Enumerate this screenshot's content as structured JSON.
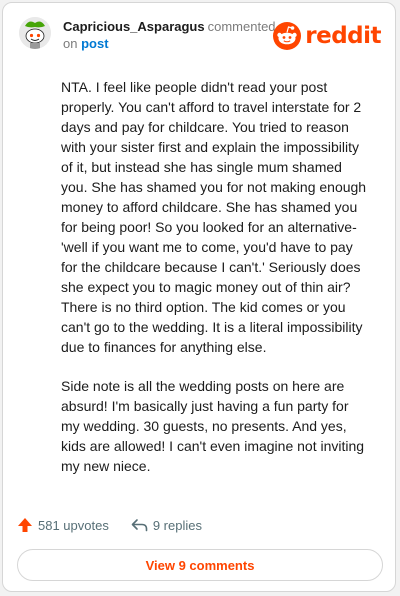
{
  "comment": {
    "username": "Capricious_Asparagus",
    "action": "commented",
    "on_text": "on",
    "post_link": "post",
    "paragraphs": [
      "NTA. I feel like people didn't read your post properly. You can't afford to travel interstate for 2 days and pay for childcare. You tried to reason with your sister first and explain the impossibility of it, but instead she has single mum shamed you. She has shamed you for not making enough money to afford childcare. She has shamed you for being poor! So you looked for an alternative- 'well if you want me to come, you'd have to pay for the childcare because I can't.' Seriously does she expect you to magic money out of thin air? There is no third option. The kid comes or you can't go to the wedding. It is a literal impossibility due to finances for anything else.",
      "Side note is all the wedding posts on here are absurd! I'm basically just having a fun party for my wedding. 30 guests, no presents. And yes, kids are allowed! I can't even imagine not inviting my new niece."
    ]
  },
  "brand": {
    "name": "reddit",
    "color": "#ff4500"
  },
  "footer": {
    "upvotes": "581 upvotes",
    "replies": "9 replies"
  },
  "view_button": {
    "label": "View 9 comments"
  },
  "icons": {
    "avatar": "snoo-avatar-icon",
    "logo": "reddit-alien-icon",
    "upvote": "upvote-arrow-icon",
    "reply": "reply-arrow-icon"
  }
}
